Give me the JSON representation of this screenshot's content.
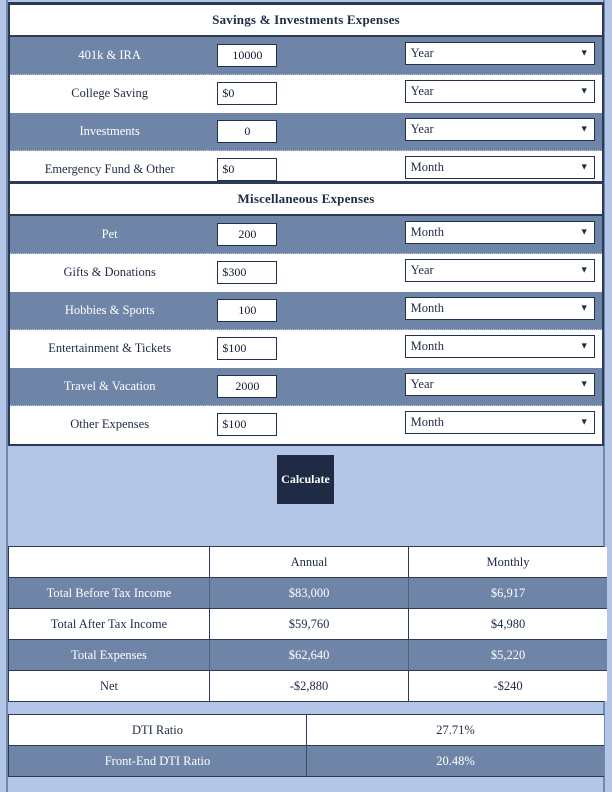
{
  "theme": {
    "page_bg": "#b3c6e7",
    "row_alt_bg": "#6f85a8",
    "row_plain_bg": "#ffffff",
    "border": "#2b3a55",
    "text_dark": "#1f2a44",
    "text_light": "#ffffff",
    "button_bg": "#1f2a44"
  },
  "sections": [
    {
      "title": "Savings & Investments Expenses",
      "rows": [
        {
          "label": "401k & IRA",
          "value": "10000",
          "align": "center",
          "period": "Year"
        },
        {
          "label": "College Saving",
          "value": "$0",
          "align": "left",
          "period": "Year"
        },
        {
          "label": "Investments",
          "value": "0",
          "align": "center",
          "period": "Year"
        },
        {
          "label": "Emergency Fund & Other",
          "value": "$0",
          "align": "left",
          "period": "Month"
        }
      ]
    },
    {
      "title": "Miscellaneous Expenses",
      "rows": [
        {
          "label": "Pet",
          "value": "200",
          "align": "center",
          "period": "Month"
        },
        {
          "label": "Gifts & Donations",
          "value": "$300",
          "align": "left",
          "period": "Year"
        },
        {
          "label": "Hobbies & Sports",
          "value": "100",
          "align": "center",
          "period": "Month"
        },
        {
          "label": "Entertainment & Tickets",
          "value": "$100",
          "align": "left",
          "period": "Month"
        },
        {
          "label": "Travel & Vacation",
          "value": "2000",
          "align": "center",
          "period": "Year"
        },
        {
          "label": "Other Expenses",
          "value": "$100",
          "align": "left",
          "period": "Month"
        }
      ]
    }
  ],
  "period_options": [
    "Month",
    "Year"
  ],
  "caret_glyph": "▼",
  "calculate": {
    "label": "Calculate"
  },
  "results": {
    "headers": [
      "",
      "Annual",
      "Monthly"
    ],
    "rows": [
      {
        "label": "Total Before Tax Income",
        "annual": "$83,000",
        "monthly": "$6,917"
      },
      {
        "label": "Total After Tax Income",
        "annual": "$59,760",
        "monthly": "$4,980"
      },
      {
        "label": "Total Expenses",
        "annual": "$62,640",
        "monthly": "$5,220"
      },
      {
        "label": "Net",
        "annual": "-$2,880",
        "monthly": "-$240"
      }
    ]
  },
  "dti": {
    "rows": [
      {
        "label": "DTI Ratio",
        "value": "27.71%"
      },
      {
        "label": "Front-End DTI Ratio",
        "value": "20.48%"
      }
    ]
  }
}
